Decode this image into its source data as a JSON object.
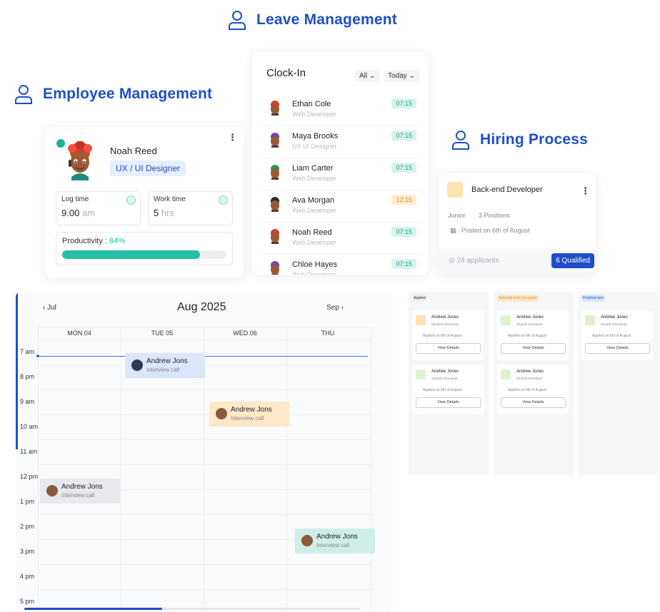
{
  "headings": {
    "leave": "Leave Management",
    "employee": "Employee Management",
    "hiring": "Hiring Process"
  },
  "employee_card": {
    "name": "Noah Reed",
    "role": "UX / UI Designer",
    "log_time_label": "Log time",
    "log_time_value": "9.00",
    "log_time_unit": "am",
    "work_time_label": "Work time",
    "work_time_value": "5",
    "work_time_unit": "hrs",
    "productivity_label": "Productivity : ",
    "productivity_value": "84%",
    "productivity_fraction": 0.84,
    "status_color": "#1ab394"
  },
  "clock_in": {
    "title": "Clock-In",
    "filter_all": "All",
    "filter_today": "Today",
    "rows": [
      {
        "name": "Ethan Cole",
        "role": "Web Developer",
        "time": "07:15",
        "late": false
      },
      {
        "name": "Maya Brooks",
        "role": "UX UI Designer",
        "time": "07:15",
        "late": false
      },
      {
        "name": "Liam Carter",
        "role": "Web Developer",
        "time": "07:15",
        "late": false
      },
      {
        "name": "Ava Morgan",
        "role": "Web Developer",
        "time": "12:15",
        "late": true
      },
      {
        "name": "Noah Reed",
        "role": "Web Developer",
        "time": "07:15",
        "late": false
      },
      {
        "name": "Chloe Hayes",
        "role": "Web Developer",
        "time": "07:15",
        "late": false
      }
    ]
  },
  "hiring_card": {
    "title": "Back-end Developer",
    "level": "Junior",
    "positions": "3 Positions",
    "posted": "Posted on 6th of August",
    "applicants": "24 applicants",
    "qualified_button": "6 Qualified"
  },
  "calendar": {
    "prev": "Jul",
    "title": "Aug 2025",
    "next": "Sep",
    "days": [
      "MON 04",
      "TUE 05",
      "WED 06",
      "THU"
    ],
    "hours": [
      "7 am",
      "8 pm",
      "9 am",
      "10 am",
      "11 am",
      "12 pm",
      "1 pm",
      "2 pm",
      "3 pm",
      "4 pm",
      "5 pm"
    ],
    "events": [
      {
        "name": "Andrew Jons",
        "type": "Interview call",
        "color": "#dbe6fb"
      },
      {
        "name": "Andrew Jons",
        "type": "Interview call",
        "color": "#fde8c8"
      },
      {
        "name": "Andrew Jons",
        "type": "Interview call",
        "color": "#e8e9ec"
      },
      {
        "name": "Andrew Jons",
        "type": "Interview call",
        "color": "#cfeee8"
      }
    ]
  },
  "kanban": {
    "columns": [
      {
        "tag": "Applied",
        "cards": [
          {
            "name": "Andrew Jones",
            "role": "Backend developer",
            "date": "Applied on 6th of August",
            "button": "View Details"
          },
          {
            "name": "Andrew Jones",
            "role": "Shopify Developer",
            "date": "Applied on 6th of August",
            "button": "View Details"
          }
        ]
      },
      {
        "tag": "Selected from 1st round",
        "cards": [
          {
            "name": "Andrew Jones",
            "role": "Shopify Developer",
            "date": "Applied on 6th of August",
            "button": "View Details"
          },
          {
            "name": "Andrew Jones",
            "role": "Shopify Developer",
            "date": "Applied on 6th of August",
            "button": "View Details"
          }
        ]
      },
      {
        "tag": "Practical test",
        "cards": [
          {
            "name": "Andrew Jones",
            "role": "Shopify Developer",
            "date": "Applied on 6th of August",
            "button": "View Details"
          }
        ]
      }
    ]
  },
  "colors": {
    "brand_blue": "#1e4fc9",
    "teal": "#23c0a5",
    "on_time_bg": "#d6f3ec",
    "late_bg": "#fdeccc"
  }
}
